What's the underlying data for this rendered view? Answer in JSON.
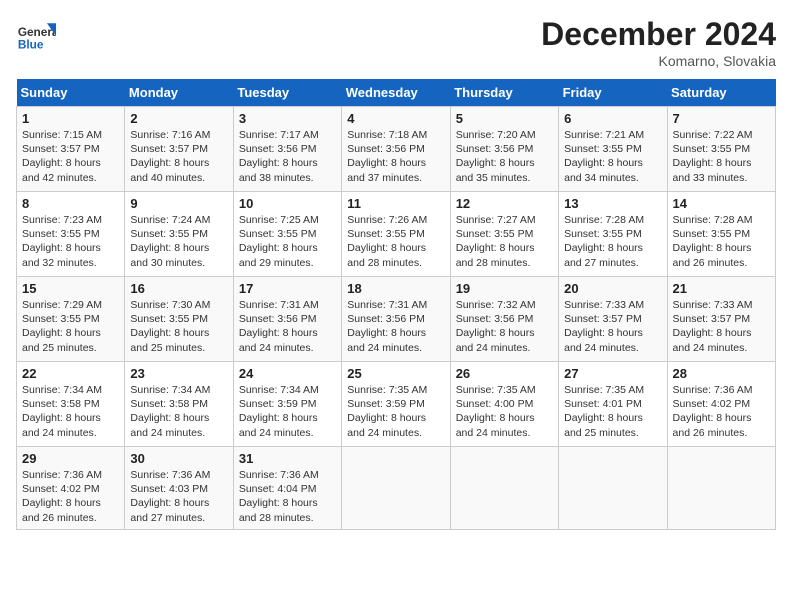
{
  "header": {
    "logo_line1": "General",
    "logo_line2": "Blue",
    "title": "December 2024",
    "subtitle": "Komarno, Slovakia"
  },
  "columns": [
    "Sunday",
    "Monday",
    "Tuesday",
    "Wednesday",
    "Thursday",
    "Friday",
    "Saturday"
  ],
  "weeks": [
    [
      {
        "day": "1",
        "info": "Sunrise: 7:15 AM\nSunset: 3:57 PM\nDaylight: 8 hours\nand 42 minutes."
      },
      {
        "day": "2",
        "info": "Sunrise: 7:16 AM\nSunset: 3:57 PM\nDaylight: 8 hours\nand 40 minutes."
      },
      {
        "day": "3",
        "info": "Sunrise: 7:17 AM\nSunset: 3:56 PM\nDaylight: 8 hours\nand 38 minutes."
      },
      {
        "day": "4",
        "info": "Sunrise: 7:18 AM\nSunset: 3:56 PM\nDaylight: 8 hours\nand 37 minutes."
      },
      {
        "day": "5",
        "info": "Sunrise: 7:20 AM\nSunset: 3:56 PM\nDaylight: 8 hours\nand 35 minutes."
      },
      {
        "day": "6",
        "info": "Sunrise: 7:21 AM\nSunset: 3:55 PM\nDaylight: 8 hours\nand 34 minutes."
      },
      {
        "day": "7",
        "info": "Sunrise: 7:22 AM\nSunset: 3:55 PM\nDaylight: 8 hours\nand 33 minutes."
      }
    ],
    [
      {
        "day": "8",
        "info": "Sunrise: 7:23 AM\nSunset: 3:55 PM\nDaylight: 8 hours\nand 32 minutes."
      },
      {
        "day": "9",
        "info": "Sunrise: 7:24 AM\nSunset: 3:55 PM\nDaylight: 8 hours\nand 30 minutes."
      },
      {
        "day": "10",
        "info": "Sunrise: 7:25 AM\nSunset: 3:55 PM\nDaylight: 8 hours\nand 29 minutes."
      },
      {
        "day": "11",
        "info": "Sunrise: 7:26 AM\nSunset: 3:55 PM\nDaylight: 8 hours\nand 28 minutes."
      },
      {
        "day": "12",
        "info": "Sunrise: 7:27 AM\nSunset: 3:55 PM\nDaylight: 8 hours\nand 28 minutes."
      },
      {
        "day": "13",
        "info": "Sunrise: 7:28 AM\nSunset: 3:55 PM\nDaylight: 8 hours\nand 27 minutes."
      },
      {
        "day": "14",
        "info": "Sunrise: 7:28 AM\nSunset: 3:55 PM\nDaylight: 8 hours\nand 26 minutes."
      }
    ],
    [
      {
        "day": "15",
        "info": "Sunrise: 7:29 AM\nSunset: 3:55 PM\nDaylight: 8 hours\nand 25 minutes."
      },
      {
        "day": "16",
        "info": "Sunrise: 7:30 AM\nSunset: 3:55 PM\nDaylight: 8 hours\nand 25 minutes."
      },
      {
        "day": "17",
        "info": "Sunrise: 7:31 AM\nSunset: 3:56 PM\nDaylight: 8 hours\nand 24 minutes."
      },
      {
        "day": "18",
        "info": "Sunrise: 7:31 AM\nSunset: 3:56 PM\nDaylight: 8 hours\nand 24 minutes."
      },
      {
        "day": "19",
        "info": "Sunrise: 7:32 AM\nSunset: 3:56 PM\nDaylight: 8 hours\nand 24 minutes."
      },
      {
        "day": "20",
        "info": "Sunrise: 7:33 AM\nSunset: 3:57 PM\nDaylight: 8 hours\nand 24 minutes."
      },
      {
        "day": "21",
        "info": "Sunrise: 7:33 AM\nSunset: 3:57 PM\nDaylight: 8 hours\nand 24 minutes."
      }
    ],
    [
      {
        "day": "22",
        "info": "Sunrise: 7:34 AM\nSunset: 3:58 PM\nDaylight: 8 hours\nand 24 minutes."
      },
      {
        "day": "23",
        "info": "Sunrise: 7:34 AM\nSunset: 3:58 PM\nDaylight: 8 hours\nand 24 minutes."
      },
      {
        "day": "24",
        "info": "Sunrise: 7:34 AM\nSunset: 3:59 PM\nDaylight: 8 hours\nand 24 minutes."
      },
      {
        "day": "25",
        "info": "Sunrise: 7:35 AM\nSunset: 3:59 PM\nDaylight: 8 hours\nand 24 minutes."
      },
      {
        "day": "26",
        "info": "Sunrise: 7:35 AM\nSunset: 4:00 PM\nDaylight: 8 hours\nand 24 minutes."
      },
      {
        "day": "27",
        "info": "Sunrise: 7:35 AM\nSunset: 4:01 PM\nDaylight: 8 hours\nand 25 minutes."
      },
      {
        "day": "28",
        "info": "Sunrise: 7:36 AM\nSunset: 4:02 PM\nDaylight: 8 hours\nand 26 minutes."
      }
    ],
    [
      {
        "day": "29",
        "info": "Sunrise: 7:36 AM\nSunset: 4:02 PM\nDaylight: 8 hours\nand 26 minutes."
      },
      {
        "day": "30",
        "info": "Sunrise: 7:36 AM\nSunset: 4:03 PM\nDaylight: 8 hours\nand 27 minutes."
      },
      {
        "day": "31",
        "info": "Sunrise: 7:36 AM\nSunset: 4:04 PM\nDaylight: 8 hours\nand 28 minutes."
      },
      null,
      null,
      null,
      null
    ]
  ]
}
